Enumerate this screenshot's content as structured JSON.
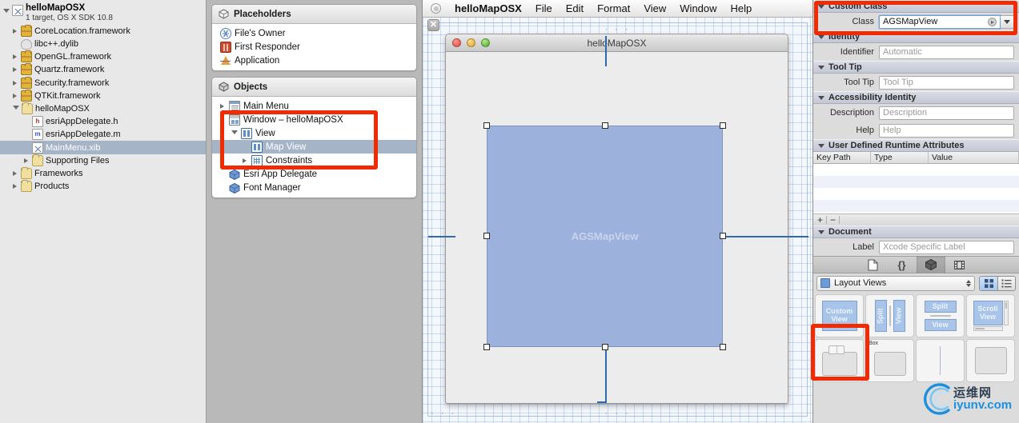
{
  "navigator": {
    "root": {
      "title": "helloMapOSX",
      "subtitle": "1 target, OS X SDK 10.8",
      "icon": "xib-project-icon"
    },
    "items": [
      {
        "label": "CoreLocation.framework",
        "icon": "framework-icon",
        "indent": 1,
        "tri": "closed"
      },
      {
        "label": "libc++.dylib",
        "icon": "dylib-icon",
        "indent": 1,
        "tri": "none"
      },
      {
        "label": "OpenGL.framework",
        "icon": "framework-icon",
        "indent": 1,
        "tri": "closed"
      },
      {
        "label": "Quartz.framework",
        "icon": "framework-icon",
        "indent": 1,
        "tri": "closed"
      },
      {
        "label": "Security.framework",
        "icon": "framework-icon",
        "indent": 1,
        "tri": "closed"
      },
      {
        "label": "QTKit.framework",
        "icon": "framework-icon",
        "indent": 1,
        "tri": "closed"
      },
      {
        "label": "helloMapOSX",
        "icon": "folder-icon",
        "indent": 1,
        "tri": "open"
      },
      {
        "label": "esriAppDelegate.h",
        "icon": "header-file-icon",
        "indent": 2,
        "tri": "none"
      },
      {
        "label": "esriAppDelegate.m",
        "icon": "implementation-file-icon",
        "indent": 2,
        "tri": "none"
      },
      {
        "label": "MainMenu.xib",
        "icon": "xib-file-icon",
        "indent": 2,
        "tri": "none",
        "selected": true
      },
      {
        "label": "Supporting Files",
        "icon": "folder-icon",
        "indent": 2,
        "tri": "closed"
      },
      {
        "label": "Frameworks",
        "icon": "folder-icon",
        "indent": 1,
        "tri": "closed"
      },
      {
        "label": "Products",
        "icon": "folder-icon",
        "indent": 1,
        "tri": "closed"
      }
    ]
  },
  "outline": {
    "placeholders": {
      "title": "Placeholders",
      "icon": "cube-outline-icon",
      "items": [
        {
          "label": "File's Owner",
          "icon": "files-owner-icon"
        },
        {
          "label": "First Responder",
          "icon": "first-responder-icon"
        },
        {
          "label": "Application",
          "icon": "application-icon"
        }
      ]
    },
    "objects": {
      "title": "Objects",
      "icon": "cube-solid-icon",
      "items": [
        {
          "label": "Main Menu",
          "icon": "main-menu-icon",
          "indent": 0,
          "tri": "closed"
        },
        {
          "label": "Window – helloMapOSX",
          "icon": "window-icon",
          "indent": 0,
          "tri": "none"
        },
        {
          "label": "View",
          "icon": "view-icon",
          "indent": 1,
          "tri": "open"
        },
        {
          "label": "Map View",
          "icon": "view-icon",
          "indent": 2,
          "tri": "none",
          "selected": true
        },
        {
          "label": "Constraints",
          "icon": "constraints-icon",
          "indent": 2,
          "tri": "closed"
        },
        {
          "label": "Esri App Delegate",
          "icon": "object-cube-icon",
          "indent": 0,
          "tri": "none"
        },
        {
          "label": "Font Manager",
          "icon": "object-cube-icon",
          "indent": 0,
          "tri": "none"
        }
      ]
    }
  },
  "canvas": {
    "menubar": {
      "apple_icon": "apple-menu-icon",
      "items": [
        "helloMapOSX",
        "File",
        "Edit",
        "Format",
        "View",
        "Window",
        "Help"
      ]
    },
    "close_badge": "✕",
    "dots": "· · ·",
    "window": {
      "title": "helloMapOSX"
    },
    "mapview": {
      "label": "AGSMapView",
      "fill": "#9cb2dc",
      "border": "#7f93bd"
    },
    "selection_handle_count": 8
  },
  "inspector": {
    "sections": [
      {
        "id": "custom_class",
        "title": "Custom Class"
      },
      {
        "id": "identity",
        "title": "Identity"
      },
      {
        "id": "tool_tip",
        "title": "Tool Tip"
      },
      {
        "id": "accessibility",
        "title": "Accessibility Identity"
      },
      {
        "id": "udra",
        "title": "User Defined Runtime Attributes"
      },
      {
        "id": "document",
        "title": "Document"
      }
    ],
    "class_field": {
      "label": "Class",
      "value": "AGSMapView"
    },
    "identifier_field": {
      "label": "Identifier",
      "placeholder": "Automatic"
    },
    "tooltip_field": {
      "label": "Tool Tip",
      "placeholder": "Tool Tip"
    },
    "description_field": {
      "label": "Description",
      "placeholder": "Description"
    },
    "help_field": {
      "label": "Help",
      "placeholder": "Help"
    },
    "udra_columns": [
      "Key Path",
      "Type",
      "Value"
    ],
    "udra_add": "+",
    "udra_remove": "−",
    "label_field": {
      "label": "Label",
      "placeholder": "Xcode Specific Label"
    }
  },
  "library": {
    "tabs": [
      {
        "name": "file-template-library-tab",
        "glyph": "⬚",
        "active": false
      },
      {
        "name": "code-snippet-library-tab",
        "glyph": "{}",
        "active": false
      },
      {
        "name": "object-library-tab",
        "glyph": "cube",
        "active": true
      },
      {
        "name": "media-library-tab",
        "glyph": "film",
        "active": false
      }
    ],
    "filter": {
      "value": "Layout Views",
      "icon": "layout-views-icon"
    },
    "view_modes": [
      {
        "name": "grid-view-toggle",
        "active": true
      },
      {
        "name": "list-view-toggle",
        "active": false
      }
    ],
    "items": [
      {
        "label": "Custom View",
        "kind": "blue",
        "selected": true
      },
      {
        "label": "Split View Vertical",
        "kind": "split-vertical",
        "parts": [
          "Split",
          "View"
        ]
      },
      {
        "label": "Split View Horizontal",
        "kind": "split-horizontal",
        "parts": [
          "Split",
          "View"
        ]
      },
      {
        "label": "Scroll View",
        "kind": "scroll",
        "parts": [
          "Scroll",
          "View"
        ]
      },
      {
        "label": "Tab View",
        "kind": "gray-tab"
      },
      {
        "label": "Box",
        "kind": "gray-box",
        "tag": "Box"
      },
      {
        "label": "Separator",
        "kind": "separator"
      },
      {
        "label": "Gray Placeholder",
        "kind": "gray-plain"
      }
    ]
  },
  "annotations": {
    "color": "#f22a00",
    "boxes": [
      {
        "name": "class-field-highlight"
      },
      {
        "name": "outline-window-view-highlight"
      },
      {
        "name": "custom-view-library-highlight"
      }
    ]
  },
  "watermark": {
    "cn": "运维网",
    "en": "iyunv.com",
    "icon": "iyunv-logo-icon"
  }
}
